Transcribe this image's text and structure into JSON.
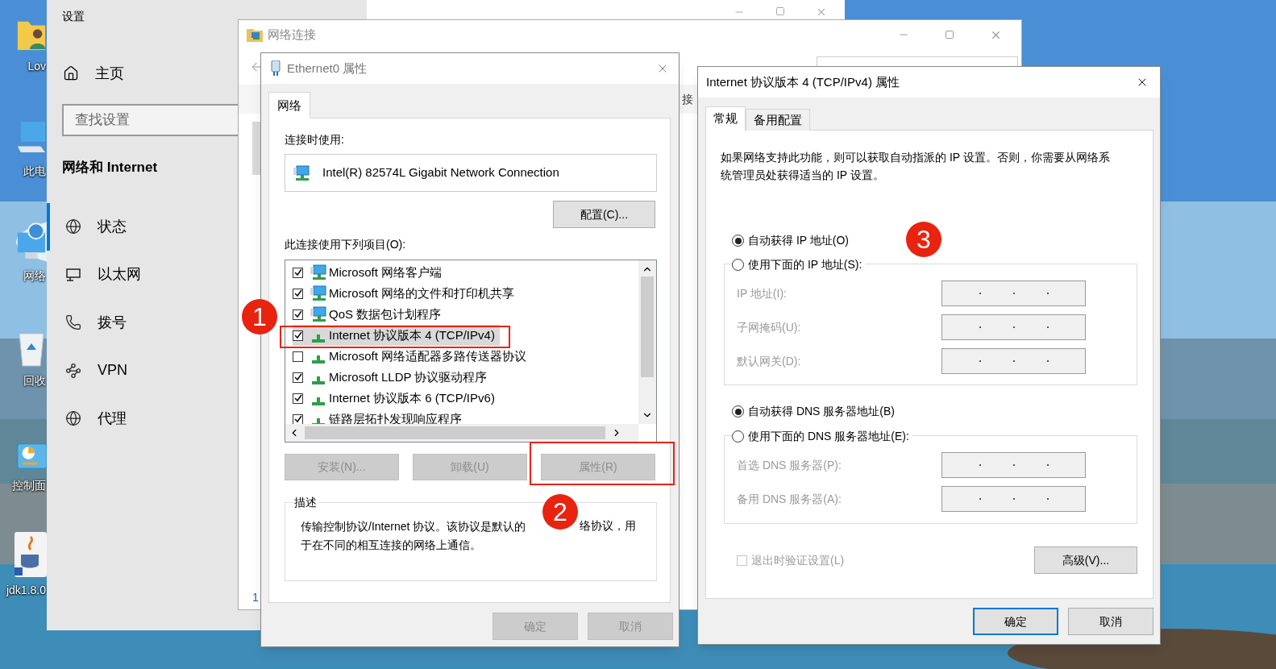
{
  "desktop": {
    "icons": [
      {
        "label": "Lov",
        "kind": "folder"
      },
      {
        "label": "此电",
        "kind": "computer"
      },
      {
        "label": "网络",
        "kind": "network"
      },
      {
        "label": "回收",
        "kind": "recycle"
      },
      {
        "label": "控制面",
        "kind": "control"
      },
      {
        "label": "jdk1.8.0",
        "kind": "app"
      }
    ]
  },
  "settings": {
    "title": "设置",
    "home": "主页",
    "search": {
      "placeholder": "查找设置"
    },
    "section": "网络和 Internet",
    "nav": [
      {
        "label": "状态",
        "kind": "status",
        "selected": true
      },
      {
        "label": "以太网",
        "kind": "ethernet",
        "selected": false
      },
      {
        "label": "拨号",
        "kind": "dialup",
        "selected": false
      },
      {
        "label": "VPN",
        "kind": "vpn",
        "selected": false
      },
      {
        "label": "代理",
        "kind": "proxy",
        "selected": false
      }
    ]
  },
  "network_connections": {
    "title": "网络连接",
    "toolbar_text": "接",
    "status": "1"
  },
  "ethernet_dialog": {
    "title": "Ethernet0 属性",
    "tabs": [
      {
        "label": "网络",
        "selected": true
      }
    ],
    "connect_using_label": "连接时使用:",
    "adapter": "Intel(R) 82574L Gigabit Network Connection",
    "configure_button": "配置(C)...",
    "items_label": "此连接使用下列项目(O):",
    "items": [
      {
        "label": "Microsoft 网络客户端",
        "kind": "client",
        "checked": true,
        "selected": false
      },
      {
        "label": "Microsoft 网络的文件和打印机共享",
        "kind": "client",
        "checked": true,
        "selected": false
      },
      {
        "label": "QoS 数据包计划程序",
        "kind": "client",
        "checked": true,
        "selected": false
      },
      {
        "label": "Internet 协议版本 4 (TCP/IPv4)",
        "kind": "protocol",
        "checked": true,
        "selected": true
      },
      {
        "label": "Microsoft 网络适配器多路传送器协议",
        "kind": "protocol",
        "checked": false,
        "selected": false
      },
      {
        "label": "Microsoft LLDP 协议驱动程序",
        "kind": "protocol",
        "checked": true,
        "selected": false
      },
      {
        "label": "Internet 协议版本 6 (TCP/IPv6)",
        "kind": "protocol",
        "checked": true,
        "selected": false
      },
      {
        "label": "链路层拓扑发现响应程序",
        "kind": "protocol",
        "checked": true,
        "selected": false
      }
    ],
    "action_buttons": [
      {
        "label": "安装(N)...",
        "disabled": true
      },
      {
        "label": "卸载(U)",
        "disabled": true
      },
      {
        "label": "属性(R)",
        "disabled": true
      }
    ],
    "description_title": "描述",
    "description": [
      "传输控制协议/Internet 协议。该协议是默认的",
      "络协议，用",
      "于在不同的相互连接的网络上通信。"
    ],
    "footer_buttons": [
      {
        "label": "确定",
        "disabled": true
      },
      {
        "label": "取消",
        "disabled": true
      }
    ]
  },
  "ipv4_dialog": {
    "title": "Internet 协议版本 4 (TCP/IPv4) 属性",
    "tabs": [
      {
        "label": "常规",
        "selected": true
      },
      {
        "label": "备用配置",
        "selected": false
      }
    ],
    "intro": "如果网络支持此功能，则可以获取自动指派的 IP 设置。否则，你需要从网络系统管理员处获得适当的 IP 设置。",
    "ip_mode": [
      {
        "label": "自动获得 IP 地址(O)",
        "selected": true
      },
      {
        "label": "使用下面的 IP 地址(S):",
        "selected": false
      }
    ],
    "ip_fields": [
      {
        "label": "IP 地址(I):",
        "disabled": true
      },
      {
        "label": "子网掩码(U):",
        "disabled": true
      },
      {
        "label": "默认网关(D):",
        "disabled": true
      }
    ],
    "dns_mode": [
      {
        "label": "自动获得 DNS 服务器地址(B)",
        "selected": true
      },
      {
        "label": "使用下面的 DNS 服务器地址(E):",
        "selected": false
      }
    ],
    "dns_fields": [
      {
        "label": "首选 DNS 服务器(P):",
        "disabled": true
      },
      {
        "label": "备用 DNS 服务器(A):",
        "disabled": true
      }
    ],
    "validate": {
      "label": "退出时验证设置(L)",
      "checked": false,
      "disabled": true
    },
    "advanced_button": "高级(V)...",
    "buttons": [
      {
        "label": "确定",
        "default": true
      },
      {
        "label": "取消",
        "default": false
      }
    ]
  },
  "annotations": [
    {
      "label": "1"
    },
    {
      "label": "2"
    },
    {
      "label": "3"
    }
  ]
}
